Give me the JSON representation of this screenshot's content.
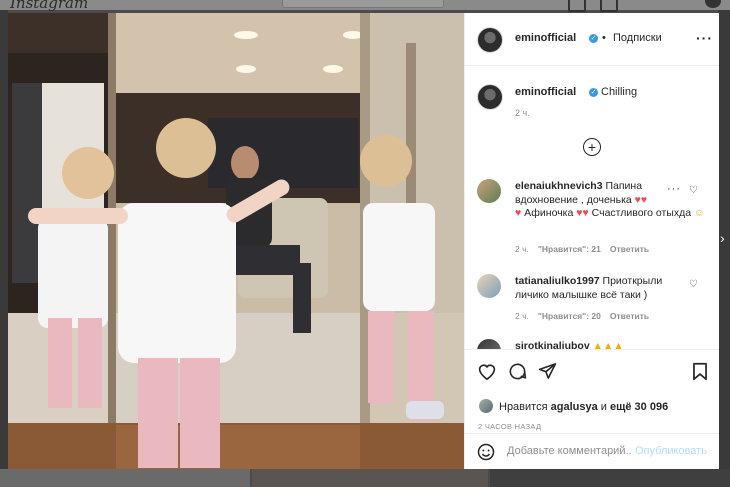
{
  "bg": {
    "logo": "Instagram",
    "thumbs": [
      "",
      "",
      ""
    ]
  },
  "post": {
    "author": "eminofficial",
    "separator": "•",
    "follow_status": "Подписки",
    "more": "•••",
    "caption_user": "eminofficial",
    "caption_text": "Chilling",
    "caption_time": "2 ч."
  },
  "comments": [
    {
      "user": "elenaiukhnevich3",
      "text": " Папина вдохновение , доченька",
      "text2": "Афиночка",
      "text3": "Счастливого отыхда",
      "time": "2 ч.",
      "likes": "\"Нравится\": 21",
      "reply": "Ответить"
    },
    {
      "user": "tatianaliulko1997",
      "text": " Приоткрыли личико малышке всё таки )",
      "time": "2 ч.",
      "likes": "\"Нравится\": 20",
      "reply": "Ответить"
    },
    {
      "user": "sirotkinaliubov",
      "text": ""
    }
  ],
  "actions": {
    "likes_prefix": "Нравится",
    "likes_user": "agalusya",
    "likes_suffix": "и",
    "likes_count": "ещё 30 096",
    "posted_time": "2 ЧАСОВ НАЗАД"
  },
  "comment_box": {
    "placeholder": "Добавьте комментарий...",
    "publish_label": "Опубликовать"
  },
  "colors": {
    "verified": "#3897f0",
    "heart_red": "#ed4956",
    "publish_disabled": "#b3dbff",
    "muted": "#8e8e8e"
  },
  "icons": [
    "heart-icon",
    "comment-icon",
    "share-icon",
    "bookmark-icon",
    "emoji-icon",
    "plus-circle-icon",
    "more-icon",
    "verified-icon"
  ]
}
